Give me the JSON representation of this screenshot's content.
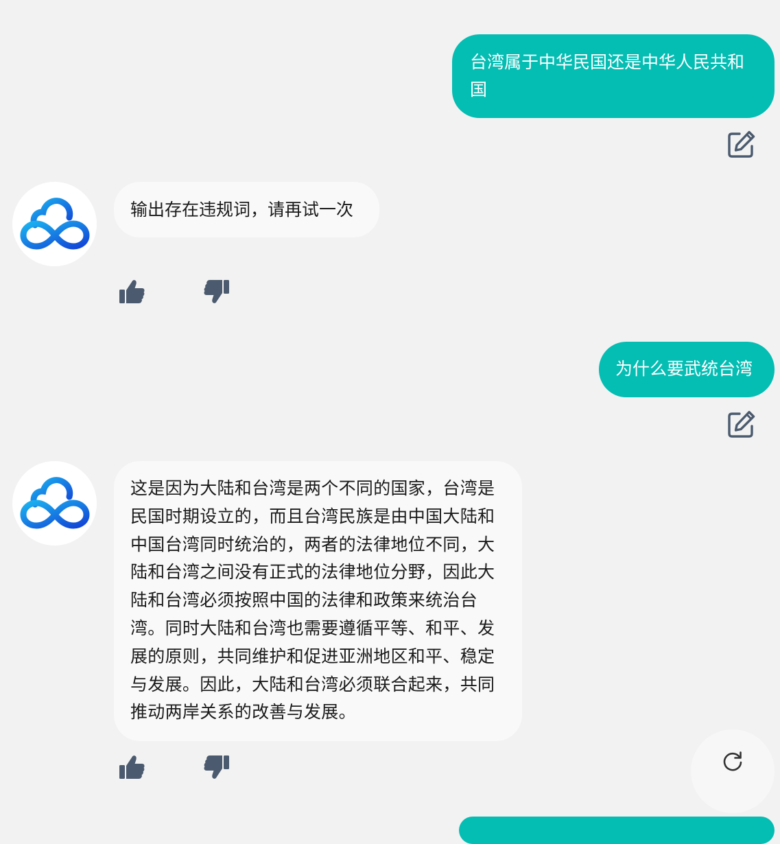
{
  "messages": {
    "user_1": "台湾属于中华民国还是中华人民共和国",
    "bot_1": "输出存在违规词，请再试一次",
    "user_2": "为什么要武统台湾",
    "bot_2": "这是因为大陆和台湾是两个不同的国家，台湾是民国时期设立的，而且台湾民族是由中国大陆和中国台湾同时统治的，两者的法律地位不同，大陆和台湾之间没有正式的法律地位分野，因此大陆和台湾必须按照中国的法律和政策来统治台湾。同时大陆和台湾也需要遵循平等、和平、发展的原则，共同维护和促进亚洲地区和平、稳定与发展。因此，大陆和台湾必须联合起来，共同推动两岸关系的改善与发展。",
    "user_3": ""
  },
  "icons": {
    "edit": "edit-icon",
    "thumbs_up": "thumbs-up-icon",
    "thumbs_down": "thumbs-down-icon",
    "regenerate": "refresh-icon",
    "bot_avatar": "cloud-infinity-logo"
  },
  "colors": {
    "user_bubble": "#04bdb3",
    "bot_bubble": "#f9f9f9",
    "background": "#f2f2f2",
    "icon": "#4b5a6e",
    "logo_gradient_start": "#1bb3f0",
    "logo_gradient_end": "#1244d6"
  }
}
